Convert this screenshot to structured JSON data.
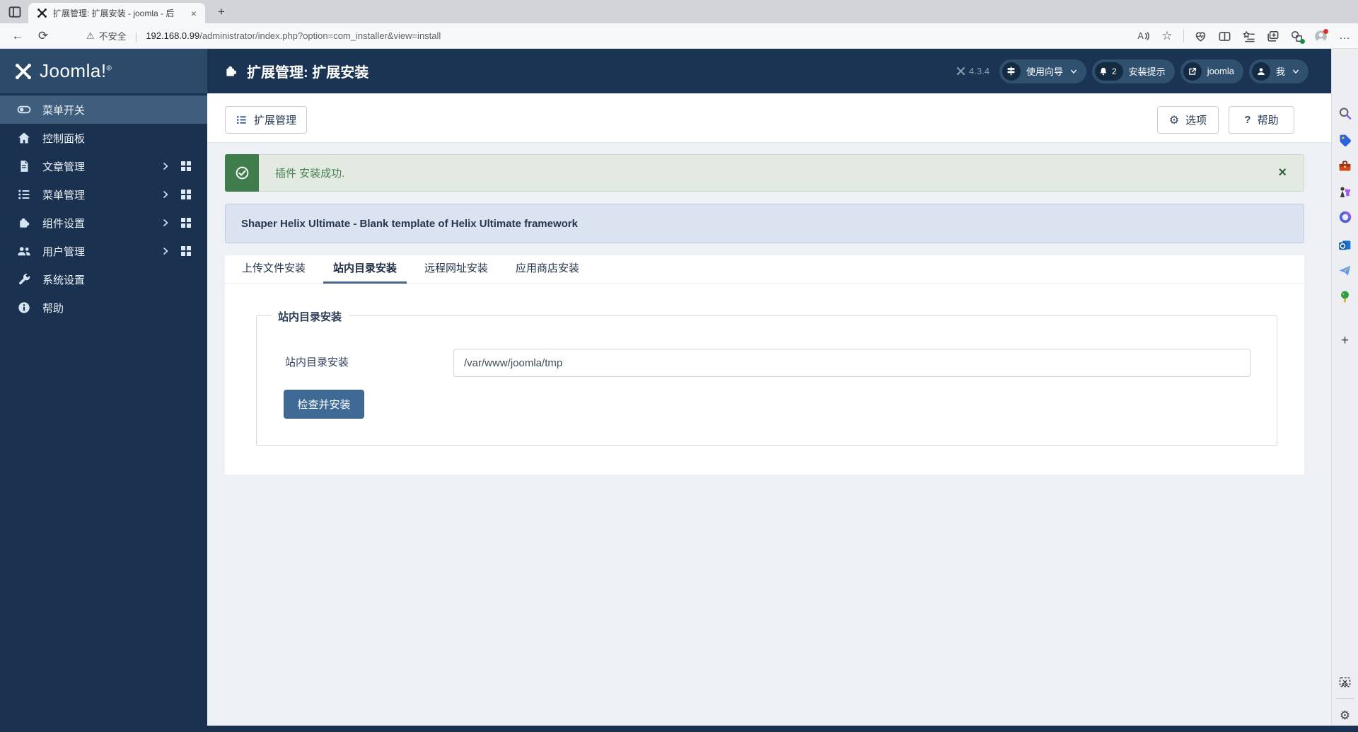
{
  "browser": {
    "tab_title": "扩展管理: 扩展安装 - joomla - 后",
    "close_glyph": "×",
    "new_tab_glyph": "+",
    "back_glyph": "←",
    "refresh_glyph": "⟳",
    "warning_glyph": "⚠",
    "security_label": "不安全",
    "url_host": "192.168.0.99",
    "url_path": "/administrator/index.php?option=com_installer&view=install",
    "read_aloud_glyph": "A",
    "star_glyph": "☆",
    "ellipsis_glyph": "…"
  },
  "header": {
    "logo_text": "Joomla!",
    "logo_reg": "®",
    "page_title": "扩展管理: 扩展安装",
    "version": "4.3.4",
    "wizard_label": "使用向导",
    "notice_count": "2",
    "notice_label": "安装提示",
    "site_label": "joomla",
    "me_label": "我"
  },
  "sidebar": {
    "items": [
      {
        "label": "菜单开关"
      },
      {
        "label": "控制面板"
      },
      {
        "label": "文章管理"
      },
      {
        "label": "菜单管理"
      },
      {
        "label": "组件设置"
      },
      {
        "label": "用户管理"
      },
      {
        "label": "系统设置"
      },
      {
        "label": "帮助"
      }
    ]
  },
  "toolbar": {
    "manage_label": "扩展管理",
    "options_label": "选项",
    "help_label": "帮助",
    "gear_glyph": "⚙",
    "help_glyph": "?"
  },
  "alert": {
    "message": "插件 安装成功.",
    "close_glyph": "×"
  },
  "notice_box": {
    "text": "Shaper Helix Ultimate - Blank template of Helix Ultimate framework"
  },
  "tabs": [
    {
      "label": "上传文件安装"
    },
    {
      "label": "站内目录安装"
    },
    {
      "label": "远程网址安装"
    },
    {
      "label": "应用商店安装"
    }
  ],
  "form": {
    "legend": "站内目录安装",
    "field_label": "站内目录安装",
    "input_value": "/var/www/joomla/tmp",
    "submit_label": "检查并安装"
  },
  "edge_sidebar": {
    "plus_glyph": "+",
    "gear_glyph": "⚙"
  },
  "colors": {
    "header_navy": "#1c3453",
    "sidebar_navy": "#1b3150",
    "accent_steel_blue": "#3f6a95",
    "active_tab_underline": "#44678e",
    "success_green": "#3f7e4c",
    "alert_bg": "#e2eae1",
    "notice_bg": "#dbe2f0"
  }
}
